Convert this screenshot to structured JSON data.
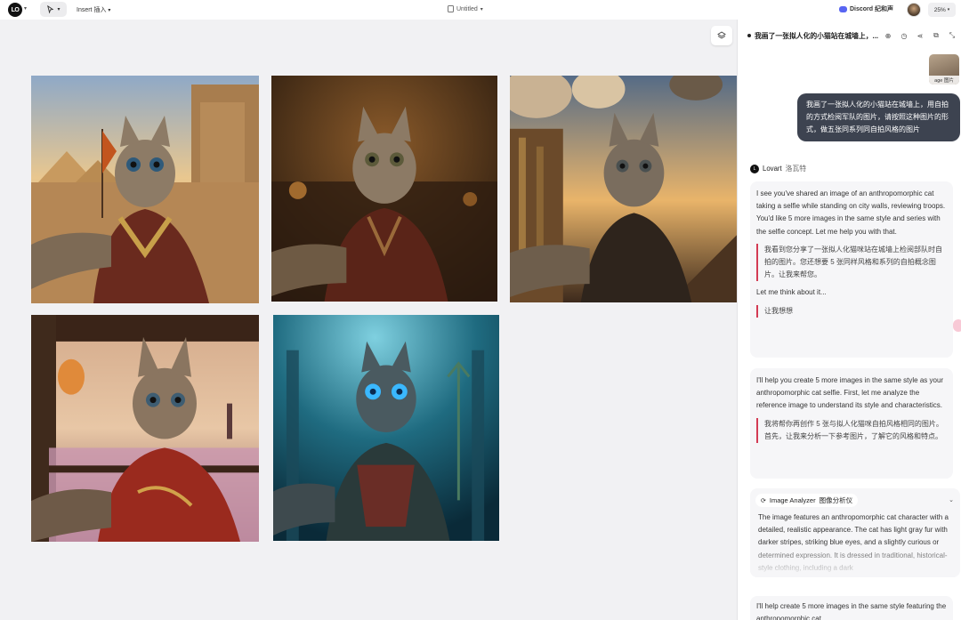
{
  "topbar": {
    "logo_text": "LO",
    "insert_label": "Insert 插入",
    "doc_title": "Untitled",
    "discord_label": "Discord 纪和声",
    "zoom": "25%"
  },
  "canvas": {
    "images": [
      {
        "alt": "cat-egypt-selfie"
      },
      {
        "alt": "cat-crowd-hall-selfie"
      },
      {
        "alt": "cat-airship-selfie"
      },
      {
        "alt": "cat-pagoda-selfie"
      },
      {
        "alt": "cat-underwater-selfie"
      }
    ]
  },
  "panel": {
    "title": "我画了一张拟人化的小猫站在城墙上，...",
    "thumb_label": "age 图片",
    "user_message": "我画了一张拟人化的小猫站在城墙上，用自拍的方式检阅军队的图片，请按照这种图片的形式，做五张同系列同自拍风格的图片",
    "agent_name": "Lovart",
    "agent_name_cn": "洛瓦特",
    "msg1": {
      "text": "I see you've shared an image of an anthropomorphic cat taking a selfie while standing on city walls, reviewing troops. You'd like 5 more images in the same style and series with the selfie concept. Let me help you with that.",
      "quote": "我看到您分享了一张拟人化猫咪站在城墙上检阅部队时自拍的图片。您还想要 5 张同样风格和系列的自拍概念图片。让我来帮您。",
      "think": "Let me think about it...",
      "think_cn": "让我想想"
    },
    "msg2": {
      "text": "I'll help you create 5 more images in the same style as your anthropomorphic cat selfie. First, let me analyze the reference image to understand its style and characteristics.",
      "quote": "我将帮你再创作 5 张与拟人化猫咪自拍风格相同的图片。首先，让我来分析一下参考图片，了解它的风格和特点。"
    },
    "tool": {
      "name": "Image Analyzer",
      "name_cn": "图像分析仪",
      "text": "The image features an anthropomorphic cat character with a detailed, realistic appearance. The cat has light gray fur with darker stripes, striking blue eyes, and a slightly curious or determined expression. It is dressed in traditional, historical-style clothing, including a dark"
    },
    "msg3": {
      "text": "I'll help create 5 more images in the same style featuring the anthropomorphic cat"
    }
  }
}
